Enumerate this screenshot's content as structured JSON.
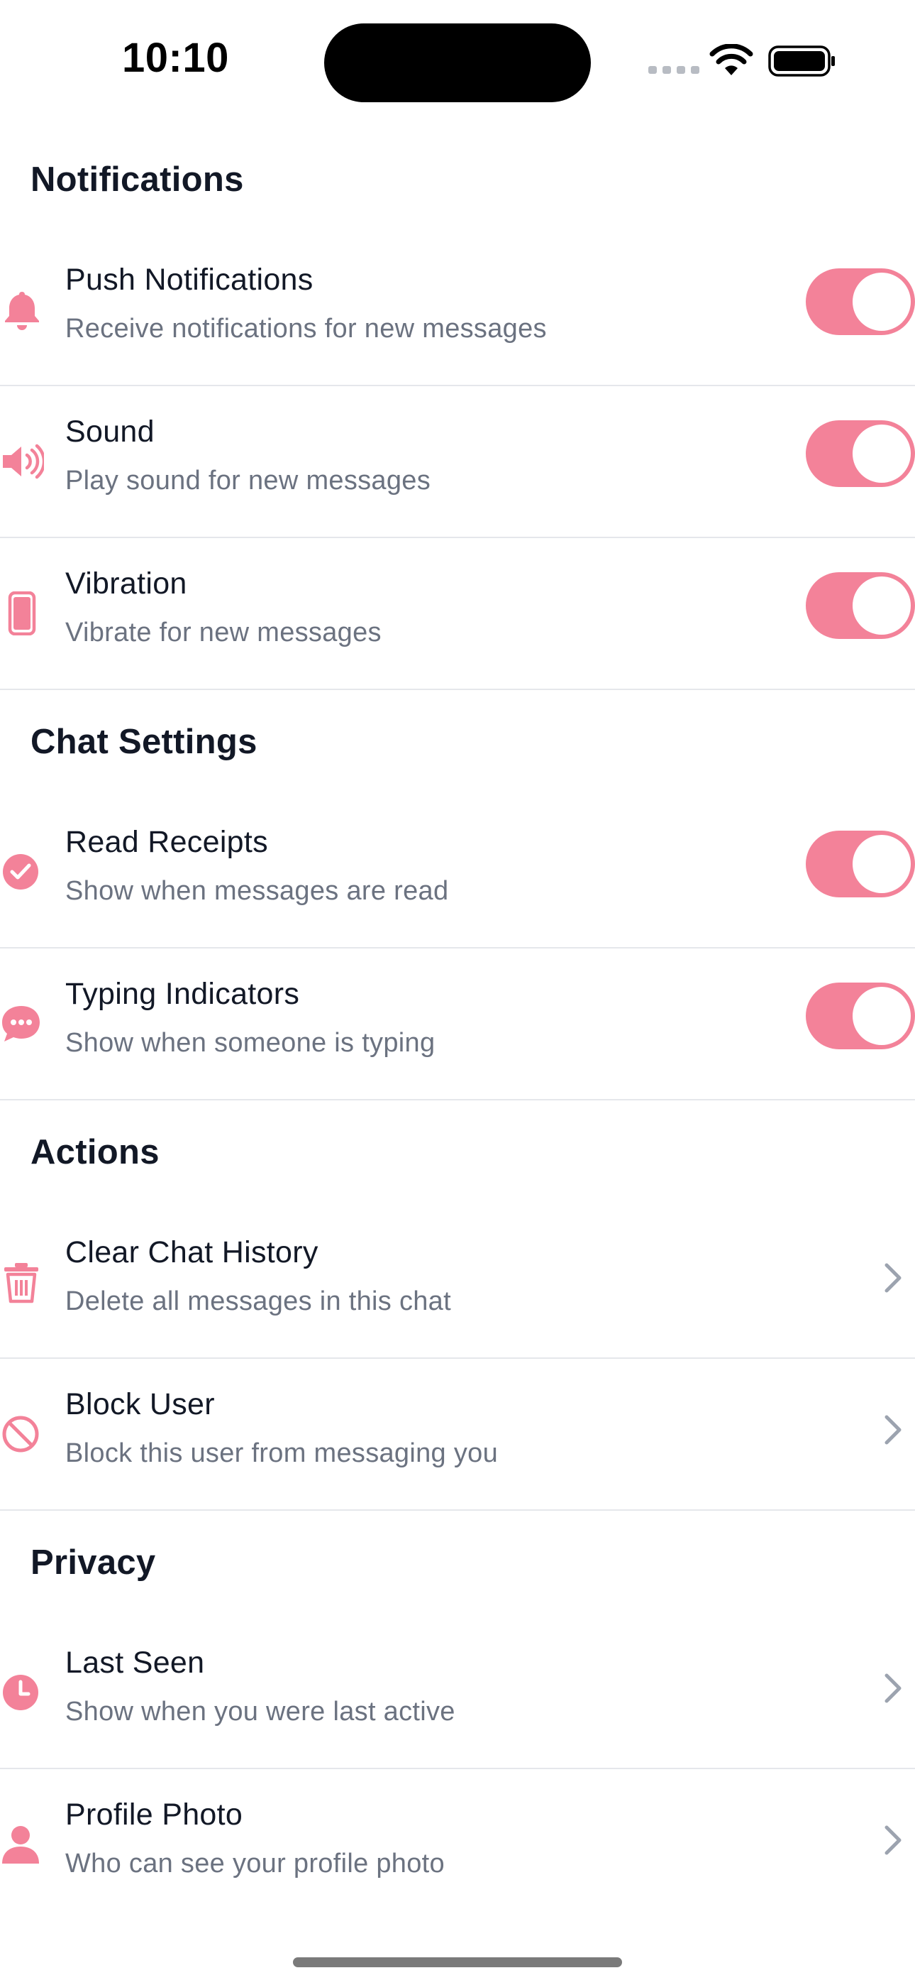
{
  "status_bar": {
    "time": "10:10"
  },
  "accent_color": "#f38299",
  "sections": {
    "notifications": {
      "title": "Notifications",
      "push": {
        "icon": "bell-icon",
        "title": "Push Notifications",
        "subtitle": "Receive notifications for new messages",
        "enabled": true
      },
      "sound": {
        "icon": "speaker-icon",
        "title": "Sound",
        "subtitle": "Play sound for new messages",
        "enabled": true
      },
      "vibration": {
        "icon": "phone-icon",
        "title": "Vibration",
        "subtitle": "Vibrate for new messages",
        "enabled": true
      }
    },
    "chat": {
      "title": "Chat Settings",
      "read_receipts": {
        "icon": "check-circle-icon",
        "title": "Read Receipts",
        "subtitle": "Show when messages are read",
        "enabled": true
      },
      "typing": {
        "icon": "chat-bubble-icon",
        "title": "Typing Indicators",
        "subtitle": "Show when someone is typing",
        "enabled": true
      }
    },
    "actions": {
      "title": "Actions",
      "clear": {
        "icon": "trash-icon",
        "title": "Clear Chat History",
        "subtitle": "Delete all messages in this chat"
      },
      "block": {
        "icon": "block-icon",
        "title": "Block User",
        "subtitle": "Block this user from messaging you"
      }
    },
    "privacy": {
      "title": "Privacy",
      "last_seen": {
        "icon": "clock-icon",
        "title": "Last Seen",
        "subtitle": "Show when you were last active"
      },
      "profile_photo": {
        "icon": "person-icon",
        "title": "Profile Photo",
        "subtitle": "Who can see your profile photo"
      }
    }
  }
}
